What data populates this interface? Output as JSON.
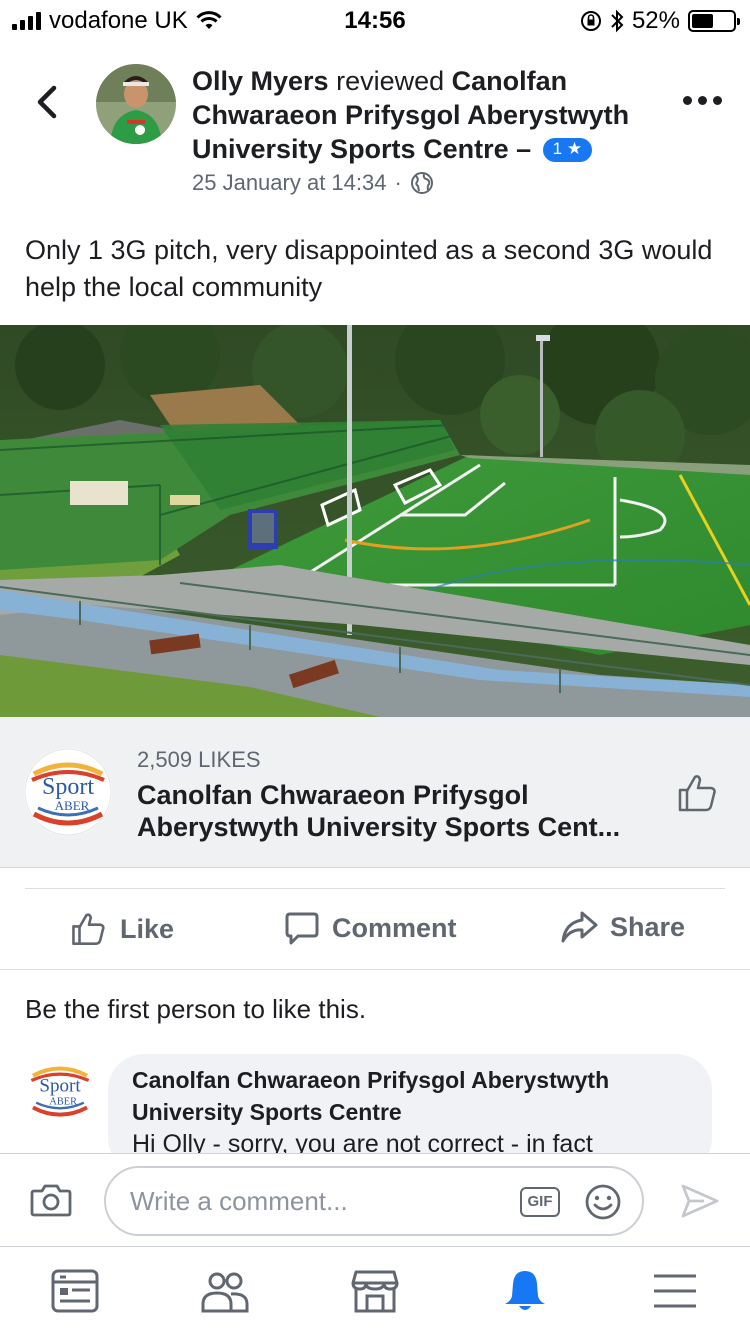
{
  "status_bar": {
    "carrier": "vodafone UK",
    "time": "14:56",
    "battery": "52%",
    "battery_level": 0.52
  },
  "review": {
    "author": "Olly Myers",
    "action": "reviewed",
    "place": "Canolfan Chwaraeon Prifysgol Aberystwyth University Sports Centre",
    "separator": "–",
    "rating_badge": "1 ★",
    "date": "25 January at 14:34",
    "dot": "·",
    "text": "Only 1 3G pitch, very disappointed as a second 3G would help the local community"
  },
  "page_card": {
    "likes": "2,509 LIKES",
    "name": "Canolfan Chwaraeon Prifysgol Aberystwyth University Sports Cent...",
    "logo_text_1": "Sport",
    "logo_text_2": "ABER"
  },
  "actions": {
    "like": "Like",
    "comment": "Comment",
    "share": "Share"
  },
  "first_like": "Be the first person to like this.",
  "comment": {
    "author": "Canolfan Chwaraeon Prifysgol Aberystwyth University Sports Centre",
    "text": "Hi Olly - sorry, you are not correct - in fact"
  },
  "composer": {
    "placeholder": "Write a comment...",
    "gif_label": "GIF"
  },
  "icons": {
    "back": "chevron-left-icon",
    "more": "more-dots-icon",
    "globe": "globe-icon",
    "camera": "camera-icon",
    "emoji": "emoji-icon",
    "send": "send-icon",
    "tabs": [
      "news-feed-icon",
      "friends-icon",
      "marketplace-icon",
      "notifications-icon",
      "menu-icon"
    ]
  },
  "colors": {
    "accent": "#1877f2",
    "text_secondary": "#606770",
    "card_bg": "#f0f1f3"
  }
}
